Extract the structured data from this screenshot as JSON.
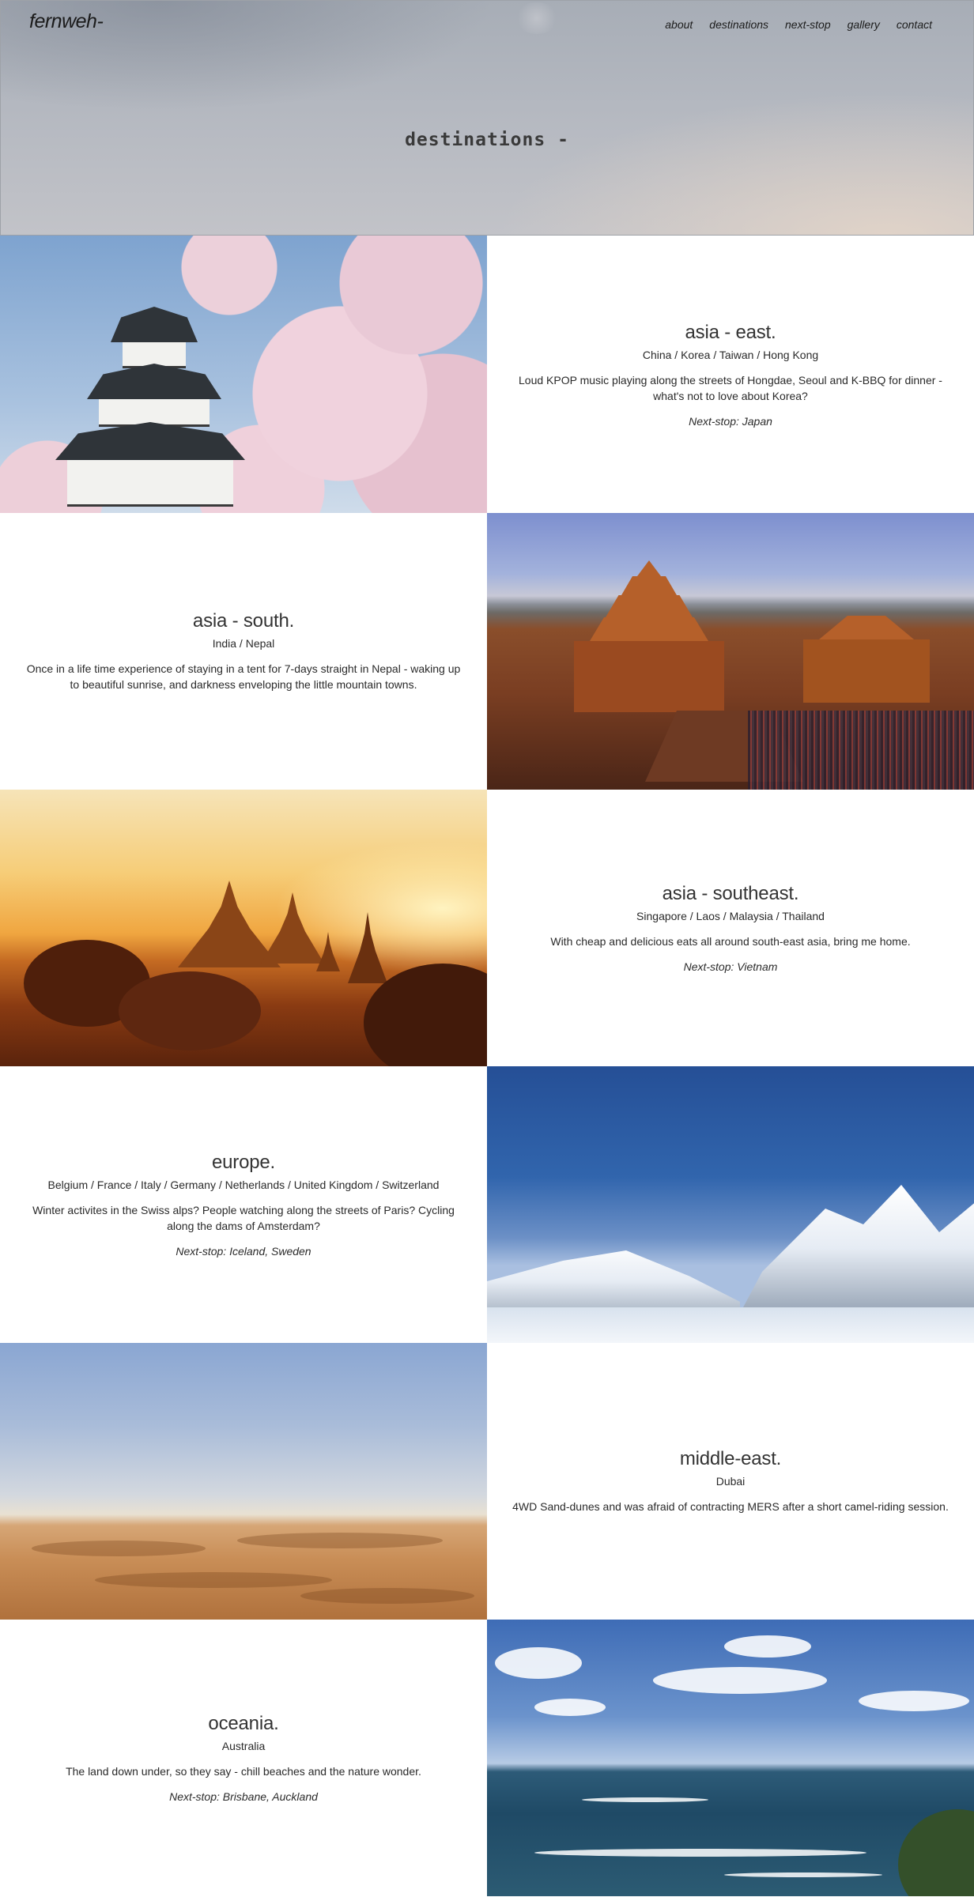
{
  "header": {
    "logo": "fernweh-",
    "nav": [
      "about",
      "destinations",
      "next-stop",
      "gallery",
      "contact"
    ],
    "title": "destinations -"
  },
  "destinations": [
    {
      "title": "asia - east.",
      "countries": "China / Korea / Taiwan / Hong Kong",
      "description": "Loud KPOP music playing along the streets of Hongdae, Seoul and K-BBQ for dinner - what's not to love about Korea?",
      "next": "Next-stop: Japan",
      "image_alt": "Japanese castle with cherry blossoms"
    },
    {
      "title": "asia - south.",
      "countries": "India / Nepal",
      "description": "Once in a life time experience of staying in a tent for 7-days straight in Nepal - waking up to beautiful sunrise, and darkness enveloping the little mountain towns.",
      "next": "",
      "image_alt": "Pagoda temples in Bhaktapur, Nepal"
    },
    {
      "title": "asia - southeast.",
      "countries": "Singapore / Laos / Malaysia / Thailand",
      "description": "With cheap and delicious eats all around south-east asia, bring me home.",
      "next": "Next-stop: Vietnam",
      "image_alt": "Bagan temples at sunset"
    },
    {
      "title": "europe.",
      "countries": "Belgium / France / Italy / Germany / Netherlands / United Kingdom / Switzerland",
      "description": "Winter activites in the Swiss alps? People watching along the streets of Paris? Cycling along the dams of Amsterdam?",
      "next": "Next-stop: Iceland, Sweden",
      "image_alt": "Snowy Swiss alps under blue sky"
    },
    {
      "title": "middle-east.",
      "countries": "Dubai",
      "description": "4WD Sand-dunes and was afraid of contracting MERS after a short camel-riding session.",
      "next": "",
      "image_alt": "Desert sand dunes in Dubai"
    },
    {
      "title": "oceania.",
      "countries": "Australia",
      "description": "The land down under, so they say - chill beaches and the nature wonder.",
      "next": "Next-stop: Brisbane, Auckland",
      "image_alt": "Bondi beach coastline"
    }
  ]
}
